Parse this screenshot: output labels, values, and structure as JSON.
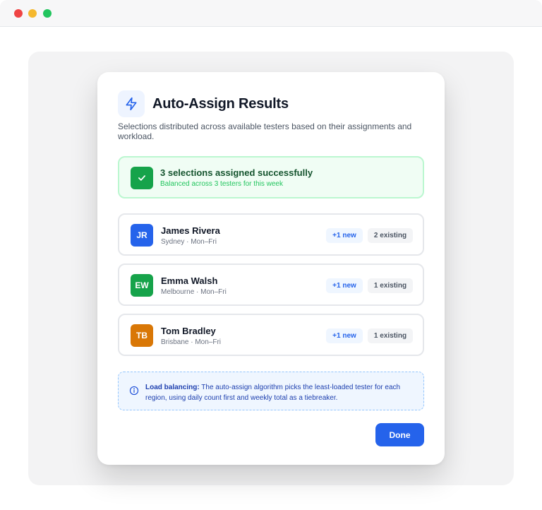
{
  "window": {
    "controls": [
      "close",
      "minimize",
      "zoom"
    ]
  },
  "modal": {
    "icon": "lightning-bolt-icon",
    "title": "Auto-Assign Results",
    "subtitle": "Selections distributed across available testers based on their assignments and workload."
  },
  "success": {
    "icon": "check-icon",
    "title": "3 selections assigned successfully",
    "subtitle": "Balanced across 3 testers for this week"
  },
  "testers": [
    {
      "initials": "JR",
      "name": "James Rivera",
      "location": "Sydney · Mon–Fri",
      "new_label": "+1 new",
      "existing_label": "2 existing",
      "color": "#2563eb"
    },
    {
      "initials": "EW",
      "name": "Emma Walsh",
      "location": "Melbourne · Mon–Fri",
      "new_label": "+1 new",
      "existing_label": "1 existing",
      "color": "#16a34a"
    },
    {
      "initials": "TB",
      "name": "Tom Bradley",
      "location": "Brisbane · Mon–Fri",
      "new_label": "+1 new",
      "existing_label": "1 existing",
      "color": "#d97706"
    }
  ],
  "info": {
    "icon": "info-icon",
    "label": "Load balancing:",
    "text": " The auto-assign algorithm picks the least-loaded tester for each region, using daily count first and weekly total as a tiebreaker."
  },
  "actions": {
    "done_label": "Done"
  },
  "colors": {
    "accent": "#2563eb",
    "success": "#16a34a"
  }
}
